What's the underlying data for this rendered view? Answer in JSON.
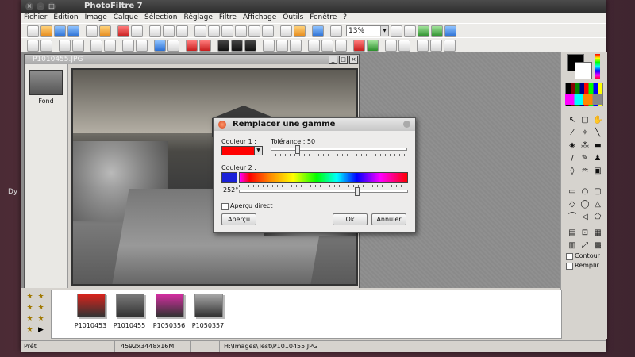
{
  "desktop": {
    "label": "Dy"
  },
  "window": {
    "title": "PhotoFiltre 7"
  },
  "menu": [
    "Fichier",
    "Edition",
    "Image",
    "Calque",
    "Sélection",
    "Réglage",
    "Filtre",
    "Affichage",
    "Outils",
    "Fenêtre",
    "?"
  ],
  "toolbar": {
    "zoom": "13%"
  },
  "document": {
    "title": "P1010455.JPG",
    "layer_name": "Fond"
  },
  "dialog": {
    "title": "Remplacer une gamme",
    "color1_label": "Couleur 1 :",
    "tolerance_label": "Tolérance : 50",
    "tolerance_value": 50,
    "color2_label": "Couleur 2 :",
    "hue_label": "252°",
    "hue_value": 252,
    "preview_label": "Aperçu direct",
    "preview_button": "Aperçu",
    "ok_button": "Ok",
    "cancel_button": "Annuler",
    "color1": "#ff0000",
    "color2": "#1a21d8"
  },
  "side": {
    "contour_label": "Contour",
    "fill_label": "Remplir"
  },
  "thumbnails": [
    {
      "name": "P1010453",
      "color": "#d8231c"
    },
    {
      "name": "P1010455",
      "color": "#7a7a7a"
    },
    {
      "name": "P1050356",
      "color": "#d32ea0"
    },
    {
      "name": "P1050357",
      "color": "#a7a7a7"
    }
  ],
  "status": {
    "state": "Prêt",
    "size": "4592x3448x16M",
    "path": "H:\\Images\\Test\\P1010455.JPG"
  }
}
